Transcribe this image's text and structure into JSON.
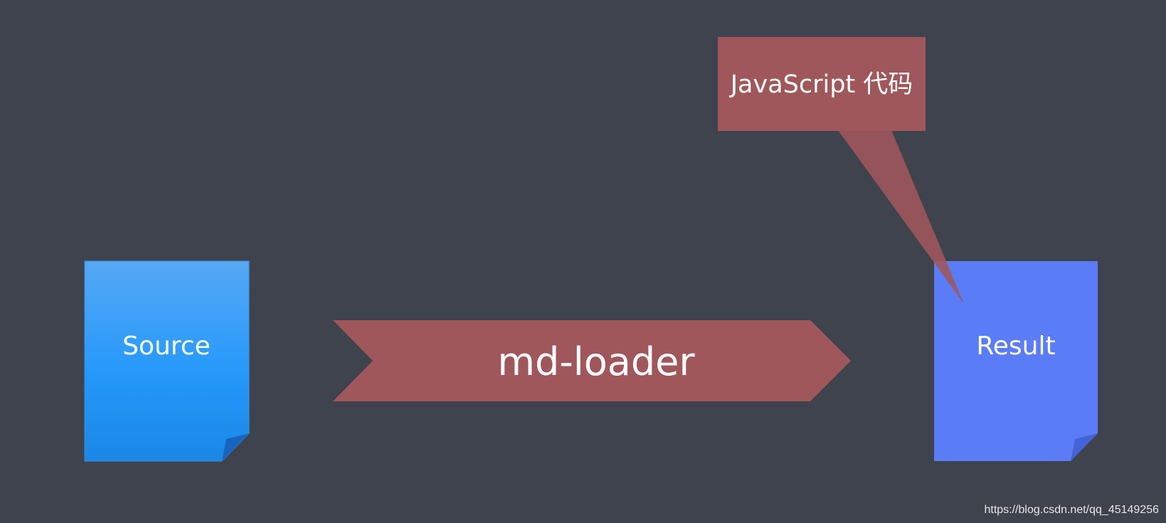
{
  "diagram": {
    "source": {
      "label": "Source"
    },
    "loader": {
      "label": "md-loader"
    },
    "result": {
      "label": "Result"
    },
    "callout": {
      "label": "JavaScript 代码"
    }
  },
  "watermark": "https://blog.csdn.net/qq_45149256",
  "colors": {
    "background": "#3f434d",
    "source_top": "#56a8f4",
    "source_bottom": "#1a87e6",
    "source_fold": "#1565c0",
    "result": "#5b7cf7",
    "result_fold": "#4563d6",
    "arrow": "#a0575b",
    "callout": "#a0575b"
  }
}
